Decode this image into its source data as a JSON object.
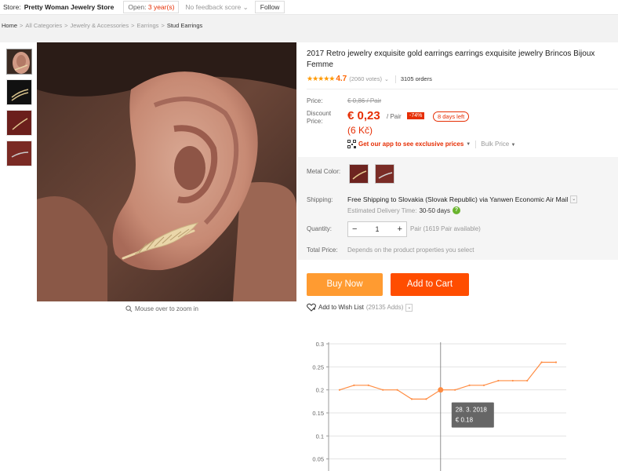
{
  "store_bar": {
    "label": "Store:",
    "store_name": "Pretty Woman Jewelry Store",
    "open_label": "Open:",
    "open_years": "3 year(s)",
    "feedback": "No feedback score",
    "follow": "Follow"
  },
  "breadcrumb": [
    "Home",
    "All Categories",
    "Jewelry & Accessories",
    "Earrings",
    "Stud Earrings"
  ],
  "gallery": {
    "zoom_hint": "Mouse over to zoom in"
  },
  "product": {
    "title": "2017 Retro jewelry exquisite gold earrings earrings exquisite jewelry Brincos Bijoux Femme",
    "stars": "★★★★★",
    "rating": "4.7",
    "votes": "(2060 votes)",
    "orders": "3105 orders"
  },
  "price": {
    "label": "Price:",
    "original": "€ 0,86 / Pair",
    "discount_label": "Discount Price:",
    "discount": "€ 0,23",
    "per": "/ Pair",
    "discount_pct": "-74%",
    "days_left": "8 days left",
    "czk": "(6 Kč)",
    "app_promo": "Get our app to see exclusive prices",
    "bulk": "Bulk Price"
  },
  "sku": {
    "color_label": "Metal Color:",
    "shipping_label": "Shipping:",
    "shipping_text": "Free Shipping to Slovakia (Slovak Republic) via Yanwen Economic Air Mail",
    "delivery_label": "Estimated Delivery Time:",
    "delivery_days": "30-50 days",
    "quantity_label": "Quantity:",
    "quantity_value": "1",
    "quantity_minus": "−",
    "quantity_plus": "+",
    "quantity_available": "Pair (1619 Pair available)",
    "total_label": "Total Price:",
    "total_text": "Depends on the product properties you select"
  },
  "actions": {
    "buy_now": "Buy Now",
    "add_to_cart": "Add to Cart",
    "wishlist": "Add to Wish List",
    "wishlist_adds": "(29135 Adds)"
  },
  "icons": {
    "zoom": "magnifier-icon",
    "qr": "qr-code-icon",
    "help": "question-icon",
    "heart": "heart-icon"
  },
  "colors": {
    "accent_red": "#e62e04",
    "buy_now": "#ff9b31",
    "add_to_cart": "#ff4d00",
    "chart_line": "#ff8c42"
  },
  "chart_data": {
    "type": "line",
    "title": "",
    "xlabel": "",
    "ylabel": "",
    "ylim": [
      0,
      0.3
    ],
    "yticks": [
      0.05,
      0.1,
      0.15,
      0.2,
      0.25,
      0.3
    ],
    "series": [
      {
        "values": [
          0.2,
          0.21,
          0.21,
          0.2,
          0.2,
          0.18,
          0.18,
          0.2,
          0.2,
          0.21,
          0.21,
          0.22,
          0.22,
          0.22,
          0.26,
          0.26
        ]
      }
    ],
    "tooltip": {
      "date": "28. 3. 2018",
      "value": "€ 0.18"
    }
  }
}
